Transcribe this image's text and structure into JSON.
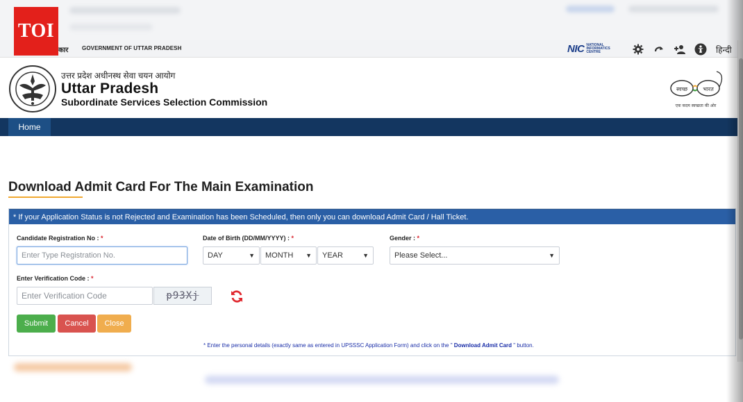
{
  "badge": {
    "text": "TOI"
  },
  "gov_strip": {
    "hindi_text": "कार",
    "english_text": "GOVERNMENT OF UTTAR PRADESH",
    "nic_logo": "NIC",
    "nic_sub": "NATIONAL INFORMATICS CENTRE",
    "icons": [
      "gear-icon",
      "redo-icon",
      "add-user-icon",
      "accessibility-icon"
    ],
    "language_link": "हिन्दी"
  },
  "header": {
    "hindi_title": "उत्तर प्रदेश अधीनस्थ सेवा चयन आयोग",
    "title": "Uttar Pradesh",
    "subtitle": "Subordinate Services Selection Commission",
    "swachh_left": "स्वच्छ",
    "swachh_right": "भारत",
    "swachh_tagline": "एक कदम स्वच्छता की ओर"
  },
  "nav": {
    "home_label": "Home"
  },
  "page": {
    "title": "Download Admit Card For The Main Examination",
    "info_bar": "* If your Application Status is not Rejected and Examination has been Scheduled, then only you can download Admit Card / Hall Ticket."
  },
  "form": {
    "registration_label": "Candidate Registration No : ",
    "registration_placeholder": "Enter Type Registration No.",
    "dob_label": "Date of Birth (DD/MM/YYYY) : ",
    "dob_day": "DAY",
    "dob_month": "MONTH",
    "dob_year": "YEAR",
    "gender_label": "Gender : ",
    "gender_value": "Please Select...",
    "verification_label": "Enter Verification Code : ",
    "verification_placeholder": "Enter Verification Code",
    "captcha_text": "p93Xj",
    "required_mark": "*",
    "submit_label": "Submit",
    "cancel_label": "Cancel",
    "close_label": "Close",
    "note_prefix": "* Enter the personal details (exactly same as entered in UPSSSC Application Form) and click on the \"",
    "note_bold": " Download Admit Card ",
    "note_suffix": "\" button."
  },
  "colors": {
    "nav_bg": "#133660",
    "info_bar_bg": "#2a5fa6",
    "submit": "#4cae4c",
    "cancel": "#d9534f",
    "close": "#f0ad4e",
    "toi_red": "#e3201b",
    "required": "#d9232d"
  }
}
